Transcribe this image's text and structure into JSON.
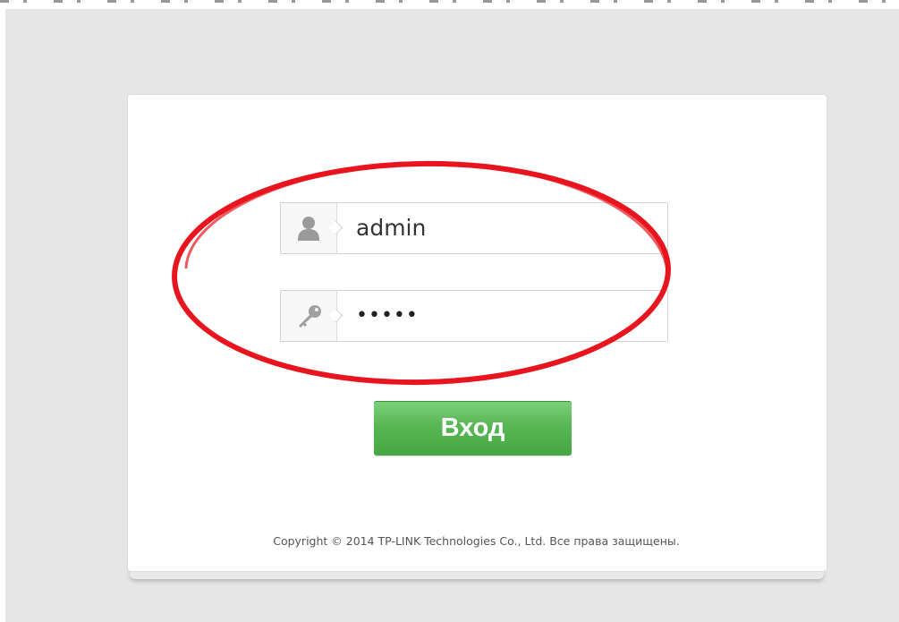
{
  "login_form": {
    "username": {
      "value": "admin",
      "icon": "user-icon"
    },
    "password": {
      "value": "•••••",
      "icon": "key-icon"
    },
    "submit_label": "Вход"
  },
  "footer": {
    "copyright": "Copyright © 2014 TP-LINK Technologies Co., Ltd. Все права защищены."
  },
  "colors": {
    "background": "#e6e6e6",
    "card": "#ffffff",
    "button": "#58b755",
    "annotation": "#e8141e"
  }
}
